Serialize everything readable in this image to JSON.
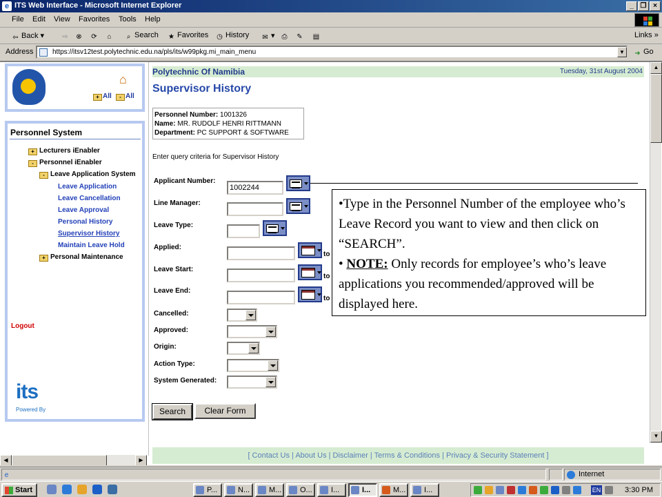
{
  "window": {
    "title": "ITS Web Interface - Microsoft Internet Explorer",
    "minimize": "_",
    "restore": "❐",
    "close": "×"
  },
  "menubar": [
    "File",
    "Edit",
    "View",
    "Favorites",
    "Tools",
    "Help"
  ],
  "toolbar": {
    "back": "Back",
    "search": "Search",
    "favorites": "Favorites",
    "history": "History",
    "links": "Links"
  },
  "address": {
    "label": "Address",
    "url": "https://itsv12test.polytechnic.edu.na/pls/its/w99pkg.mi_main_menu",
    "go": "Go"
  },
  "sidebar": {
    "all_1": "All",
    "all_2": "All",
    "title": "Personnel System",
    "nodes": {
      "lecturers": "Lecturers iEnabler",
      "personnel": "Personnel iEnabler",
      "leave_system": "Leave Application System",
      "personal_maint": "Personal Maintenance"
    },
    "leaves": [
      "Leave Application",
      "Leave Cancellation",
      "Leave Approval",
      "Personal History",
      "Supervisor History",
      "Maintain Leave Hold"
    ],
    "logout": "Logout",
    "its_logo": "its",
    "powered_by": "Powered By"
  },
  "page": {
    "org": "Polytechnic Of Namibia",
    "date": "Tuesday, 31st August 2004",
    "title": "Supervisor History",
    "personnel_number_label": "Personnel Number:",
    "personnel_number": "1001326",
    "name_label": "Name:",
    "name": "MR. RUDOLF HENRI RITTMANN",
    "department_label": "Department:",
    "department": "PC SUPPORT & SOFTWARE",
    "query_hint": "Enter query criteria for Supervisor History"
  },
  "form": {
    "applicant_number_label": "Applicant Number:",
    "applicant_number": "1002244",
    "line_manager_label": "Line Manager:",
    "leave_type_label": "Leave Type:",
    "applied_label": "Applied:",
    "leave_start_label": "Leave Start:",
    "leave_end_label": "Leave End:",
    "to": "to",
    "cancelled_label": "Cancelled:",
    "approved_label": "Approved:",
    "origin_label": "Origin:",
    "action_type_label": "Action Type:",
    "system_generated_label": "System Generated:",
    "search_button": "Search",
    "clear_button": "Clear Form"
  },
  "callout": {
    "bullet": "•",
    "line1": "Type in the Personnel Number of the employee who’s Leave Record you want to view and then click on “SEARCH”.",
    "note_label": "NOTE:",
    "line2": " Only records for employee’s who’s leave applications you recommended/approved will be displayed here."
  },
  "footer": "[ Contact Us | About Us | Disclaimer | Terms & Conditions | Privacy & Security Statement ]",
  "statusbar": {
    "zone": "Internet"
  },
  "taskbar": {
    "start": "Start",
    "tasks": [
      "P...",
      "N...",
      "M...",
      "O...",
      "I...",
      "I...",
      "M...",
      "I..."
    ],
    "language": "EN",
    "clock": "3:30 PM"
  }
}
